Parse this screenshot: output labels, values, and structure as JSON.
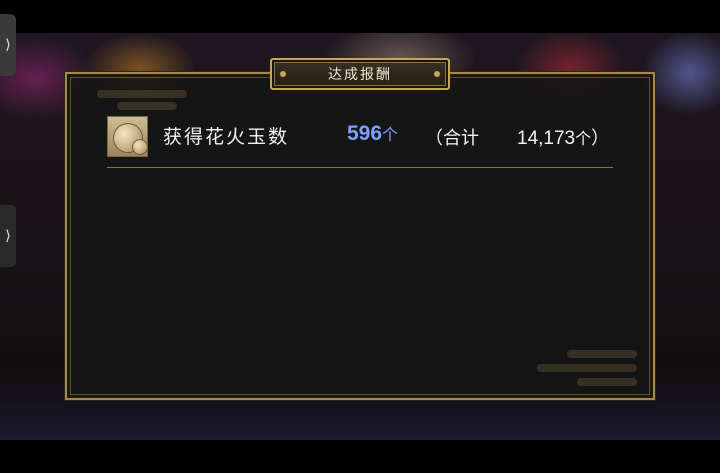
{
  "panel": {
    "title": "达成报酬"
  },
  "reward": {
    "icon": "firework-ball-icon",
    "label": "获得花火玉数",
    "count": "596",
    "count_unit": "个",
    "total_open": "（合计",
    "total": "14,173",
    "total_unit": "个",
    "total_close": "）"
  },
  "side_tabs": {
    "top_symbol": "⟩",
    "middle_symbol": "⟩"
  },
  "colors": {
    "frame_gold": "#a58a4c",
    "count_blue": "#7ea0ff"
  }
}
